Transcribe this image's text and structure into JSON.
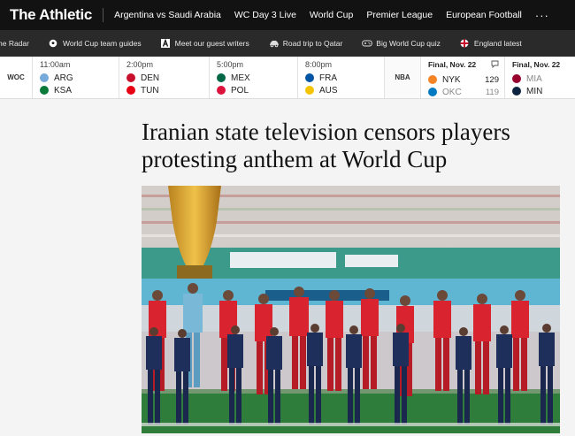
{
  "brand": {
    "logo": "The Athletic"
  },
  "topnav": {
    "links": [
      "Argentina vs Saudi Arabia",
      "WC Day 3 Live",
      "World Cup",
      "Premier League",
      "European Football"
    ],
    "more": "···"
  },
  "subnav": {
    "items": [
      {
        "label": "he Radar",
        "icon": "radar-icon"
      },
      {
        "label": "World Cup team guides",
        "icon": "soccer-ball-icon"
      },
      {
        "label": "Meet our guest writers",
        "icon": "athletic-a-icon"
      },
      {
        "label": "Road trip to Qatar",
        "icon": "car-icon"
      },
      {
        "label": "Big World Cup quiz",
        "icon": "gamepad-icon"
      },
      {
        "label": "England latest",
        "icon": "england-flag-icon"
      }
    ]
  },
  "scoreboard": {
    "woc": {
      "league": "WOC",
      "games": [
        {
          "time": "11:00am",
          "home": "ARG",
          "away": "KSA",
          "home_color": "#75aadb",
          "away_color": "#0a7a3a"
        },
        {
          "time": "2:00pm",
          "home": "DEN",
          "away": "TUN",
          "home_color": "#c8102e",
          "away_color": "#e70013"
        },
        {
          "time": "5:00pm",
          "home": "MEX",
          "away": "POL",
          "home_color": "#006847",
          "away_color": "#dc143c"
        },
        {
          "time": "8:00pm",
          "home": "FRA",
          "away": "AUS",
          "home_color": "#0055a4",
          "away_color": "#f5c400"
        }
      ]
    },
    "nba": {
      "league": "NBA",
      "games": [
        {
          "status": "Final, Nov. 22",
          "home": "NYK",
          "home_score": "129",
          "away": "OKC",
          "away_score": "119",
          "home_color": "#f58426",
          "away_color": "#007ac1",
          "away_muted": true,
          "icon": "chat-icon"
        },
        {
          "status": "Final, Nov. 22",
          "home": "MIA",
          "home_score": "",
          "away": "MIN",
          "away_score": "",
          "home_color": "#98002e",
          "away_color": "#0c2340",
          "home_muted": true
        }
      ]
    }
  },
  "article": {
    "headline": "Iranian state television censors players protesting anthem at World Cup"
  },
  "colors": {
    "topnav_bg": "#121212",
    "subnav_bg": "#2a2a2a",
    "kit_red": "#d9232e",
    "kit_navy": "#1f2f5c"
  }
}
